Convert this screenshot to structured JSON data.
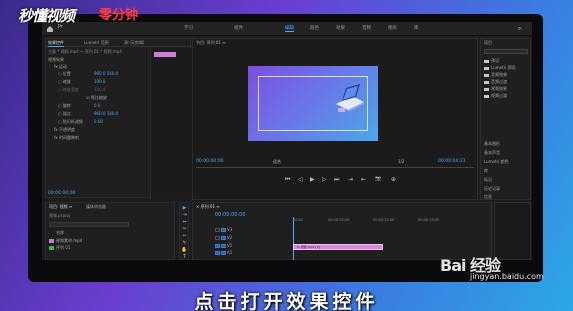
{
  "watermark": {
    "brand": "秒懂视频",
    "brand_red": "零分钟",
    "baidu": "Bai 经验",
    "baidu_url": "jingyan.baidu.com"
  },
  "caption": "点击打开效果控件",
  "topbar": {
    "ghost": "Pr",
    "workspaces": [
      {
        "label": "学习",
        "active": false
      },
      {
        "label": "组件",
        "active": false
      },
      {
        "label": "编辑",
        "active": true
      },
      {
        "label": "颜色",
        "active": false
      },
      {
        "label": "效果",
        "active": false
      },
      {
        "label": "音频",
        "active": false
      },
      {
        "label": "图形",
        "active": false
      },
      {
        "label": "库",
        "active": false
      }
    ]
  },
  "effect_controls": {
    "tabs": [
      {
        "label": "效果控件",
        "active": true
      },
      {
        "label": "Lumetri 范围",
        "active": false
      },
      {
        "label": "源:(无剪辑)",
        "active": false
      }
    ],
    "clip_header": "主要 * 视频.mp4 ~ 序列 01 * 视频.mp4",
    "section": "视频效果",
    "rows": [
      {
        "label": "fx 运动",
        "value": ""
      },
      {
        "label": "○ 位置",
        "value": "960.0   540.0"
      },
      {
        "label": "○ 缩放",
        "value": "100.0"
      },
      {
        "label": "○ 缩放宽度",
        "value": "100.0"
      },
      {
        "label": "☑ 等比缩放",
        "value": ""
      },
      {
        "label": "○ 旋转",
        "value": "0.0"
      },
      {
        "label": "○ 锚点",
        "value": "960.0   540.0"
      },
      {
        "label": "○ 防闪烁滤镜",
        "value": "0.00"
      },
      {
        "label": "fx 不透明度",
        "value": ""
      },
      {
        "label": "fx 时间重映射",
        "value": ""
      }
    ],
    "timecode": "00:00:00:00"
  },
  "program": {
    "title": "节目: 序列 01 ≡",
    "timecode_left": "00:00:00:00",
    "fit": "适合",
    "ratio": "1/2",
    "timecode_right": "00:00:04:23",
    "controls": [
      "⏮",
      "◁",
      "▶",
      "▷",
      "⏭",
      "⇥",
      "⇤",
      "📷",
      "⊕"
    ]
  },
  "right_panel": {
    "title": "项目",
    "items": [
      "预设",
      "Lumetri 预设",
      "音频效果",
      "音频过渡",
      "视频效果",
      "视频过渡"
    ],
    "footer_items": [
      "基本图形",
      "基本声音",
      "Lumetri 颜色",
      "库",
      "标记",
      "历史记录",
      "信息"
    ]
  },
  "project": {
    "tabs": [
      "项目: 视频 ≡",
      "媒体浏览器"
    ],
    "path": "视频.prproj",
    "column": "名称",
    "items": [
      {
        "name": "视频素材.mp4",
        "kind": "video"
      },
      {
        "name": "序列 01",
        "kind": "sequence"
      }
    ]
  },
  "tools": [
    "▶",
    "⇥",
    "⇔",
    "✂",
    "⇿",
    "✎",
    "✋",
    "T"
  ],
  "timeline": {
    "title": "× 序列 01 ≡",
    "timecode": "00:00:00:00",
    "ticks": [
      "00:00",
      "00:00:05:00",
      "00:00:10:00",
      "00:00:15:00"
    ],
    "tracks": [
      "V3",
      "V2",
      "V1",
      "A1",
      "A2",
      "A3"
    ],
    "clip_label": "fx 视频.mp4 [V]"
  },
  "colors": {
    "accent": "#4da6ff",
    "clip": "#d889dd",
    "panel": "#1f1f1f"
  }
}
